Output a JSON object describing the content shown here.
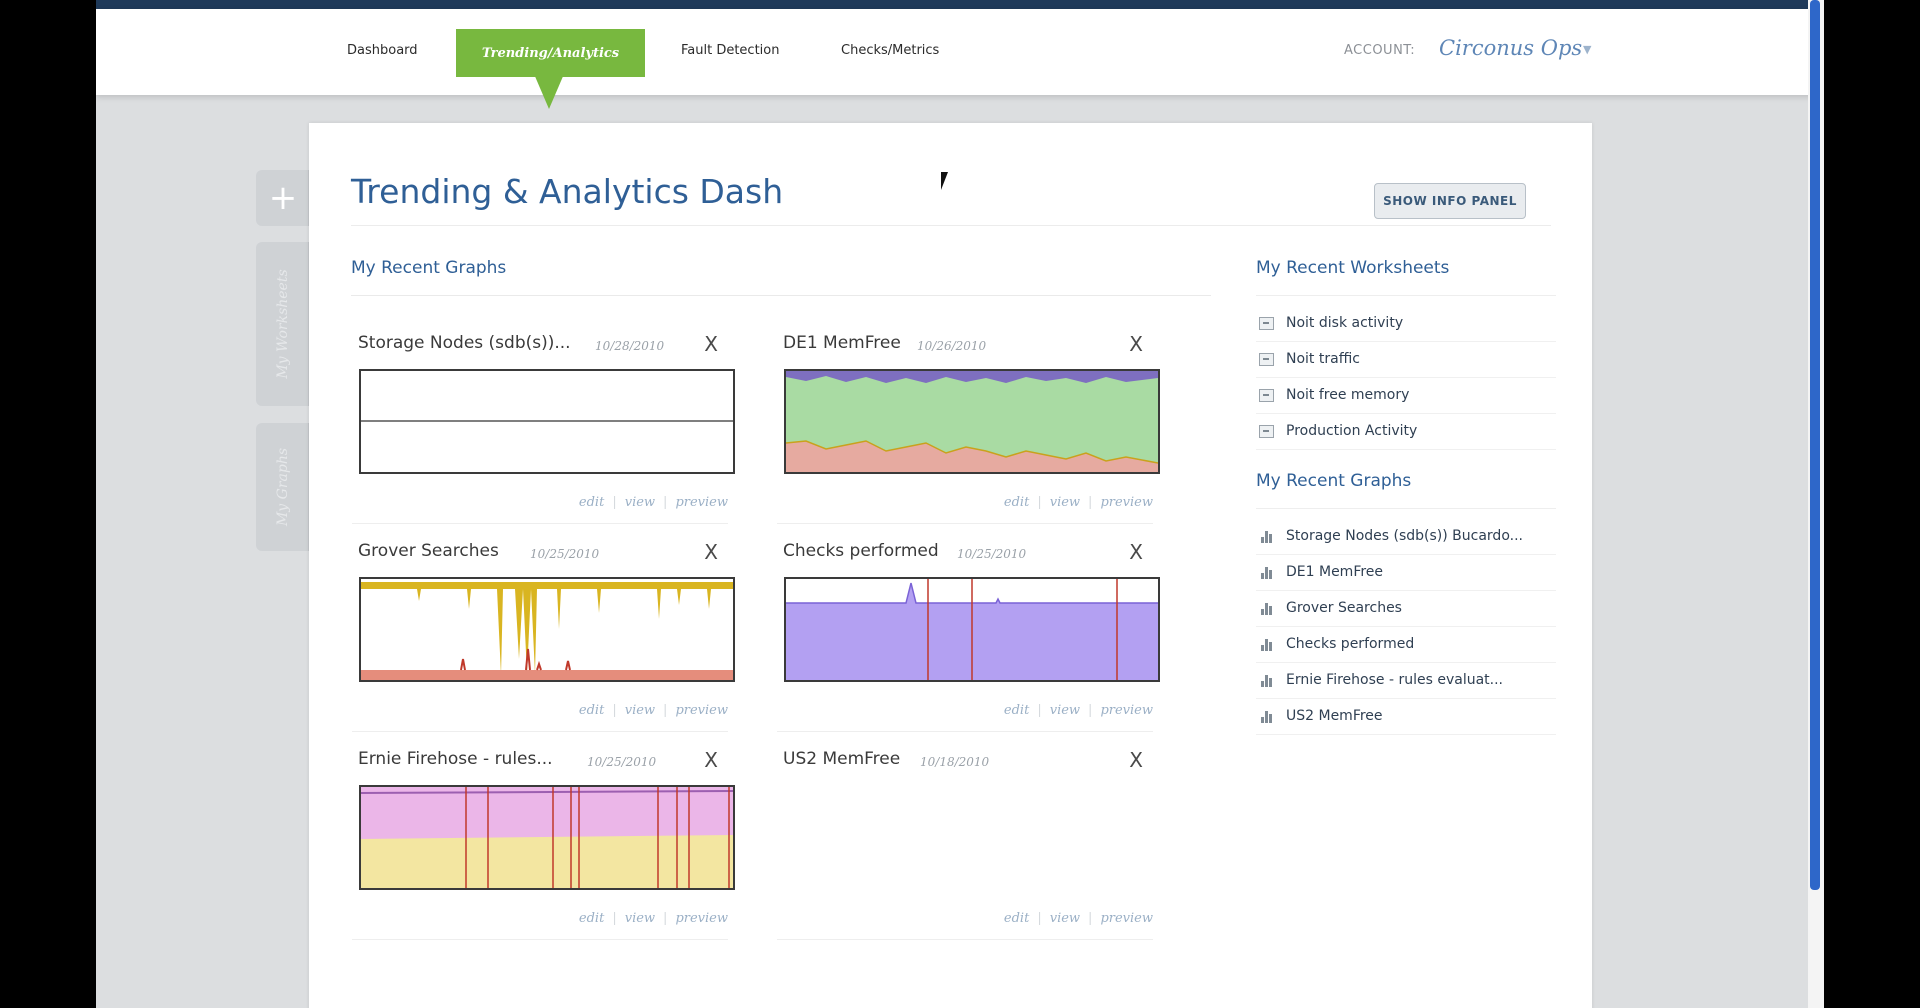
{
  "nav": {
    "items": [
      "Dashboard",
      "Trending/Analytics",
      "Fault Detection",
      "Checks/Metrics"
    ],
    "account_label": "ACCOUNT:",
    "account_name": "Circonus Ops"
  },
  "sidebar": {
    "add_symbol": "+",
    "tabs": [
      "My Worksheets",
      "My Graphs"
    ]
  },
  "main": {
    "title": "Trending & Analytics Dash",
    "info_button": "SHOW INFO PANEL",
    "graphs_heading": "My Recent Graphs",
    "cards": [
      {
        "title": "Storage Nodes (sdb(s))...",
        "date": "10/28/2010",
        "close": "X"
      },
      {
        "title": "DE1 MemFree",
        "date": "10/26/2010",
        "close": "X"
      },
      {
        "title": "Grover Searches",
        "date": "10/25/2010",
        "close": "X"
      },
      {
        "title": "Checks performed",
        "date": "10/25/2010",
        "close": "X"
      },
      {
        "title": "Ernie Firehose - rules...",
        "date": "10/25/2010",
        "close": "X"
      },
      {
        "title": "US2 MemFree",
        "date": "10/18/2010",
        "close": "X"
      }
    ],
    "actions": {
      "edit": "edit",
      "view": "view",
      "preview": "preview",
      "separator": "|"
    }
  },
  "right_panel": {
    "worksheets_heading": "My Recent Worksheets",
    "worksheets": [
      "Noit disk activity",
      "Noit traffic",
      "Noit free memory",
      "Production Activity"
    ],
    "graphs_heading": "My Recent Graphs",
    "graphs": [
      "Storage Nodes (sdb(s)) Bucardo...",
      "DE1 MemFree",
      "Grover Searches",
      "Checks performed",
      "Ernie Firehose - rules evaluat...",
      "US2 MemFree"
    ]
  },
  "colors": {
    "accent_green": "#78b83f",
    "title_blue": "#2f5f96",
    "memfree_green": "#a9dba3",
    "memfree_red": "#e6aaa0",
    "grover_yellow": "#d9b521",
    "checks_purple": "#b3a0f2",
    "ernie_pink": "#ebb6e8",
    "ernie_yellow": "#f3e6a1",
    "marker_red": "#c0392b",
    "scrollbar_blue": "#2e67c9"
  }
}
